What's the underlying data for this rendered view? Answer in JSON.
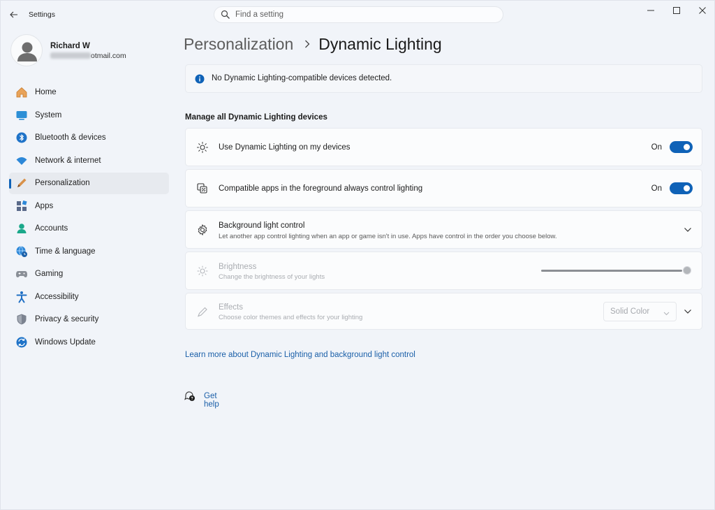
{
  "window": {
    "title": "Settings",
    "search_placeholder": "Find a setting"
  },
  "profile": {
    "name": "Richard W",
    "email_visible_suffix": "otmail.com"
  },
  "sidebar": {
    "items": [
      {
        "label": "Home",
        "icon": "home-icon"
      },
      {
        "label": "System",
        "icon": "system-icon"
      },
      {
        "label": "Bluetooth & devices",
        "icon": "bluetooth-icon"
      },
      {
        "label": "Network & internet",
        "icon": "network-icon"
      },
      {
        "label": "Personalization",
        "icon": "personalization-icon",
        "active": true
      },
      {
        "label": "Apps",
        "icon": "apps-icon"
      },
      {
        "label": "Accounts",
        "icon": "accounts-icon"
      },
      {
        "label": "Time & language",
        "icon": "time-language-icon"
      },
      {
        "label": "Gaming",
        "icon": "gaming-icon"
      },
      {
        "label": "Accessibility",
        "icon": "accessibility-icon"
      },
      {
        "label": "Privacy & security",
        "icon": "privacy-icon"
      },
      {
        "label": "Windows Update",
        "icon": "windows-update-icon"
      }
    ]
  },
  "breadcrumb": {
    "parent": "Personalization",
    "current": "Dynamic Lighting"
  },
  "info_bar": {
    "text": "No Dynamic Lighting-compatible devices detected."
  },
  "section": {
    "title": "Manage all Dynamic Lighting devices"
  },
  "settings": {
    "use_dynamic": {
      "title": "Use Dynamic Lighting on my devices",
      "state": "On"
    },
    "compatible_apps": {
      "title": "Compatible apps in the foreground always control lighting",
      "state": "On"
    },
    "background": {
      "title": "Background light control",
      "subtitle": "Let another app control lighting when an app or game isn't in use. Apps have control in the order you choose below."
    },
    "brightness": {
      "title": "Brightness",
      "subtitle": "Change the brightness of your lights",
      "value": 1.0
    },
    "effects": {
      "title": "Effects",
      "subtitle": "Choose color themes and effects for your lighting",
      "selected": "Solid Color"
    }
  },
  "links": {
    "learn_more": "Learn more about Dynamic Lighting and background light control",
    "get_help": "Get help"
  },
  "colors": {
    "accent": "#0f62b7",
    "link": "#1a5fa8"
  }
}
